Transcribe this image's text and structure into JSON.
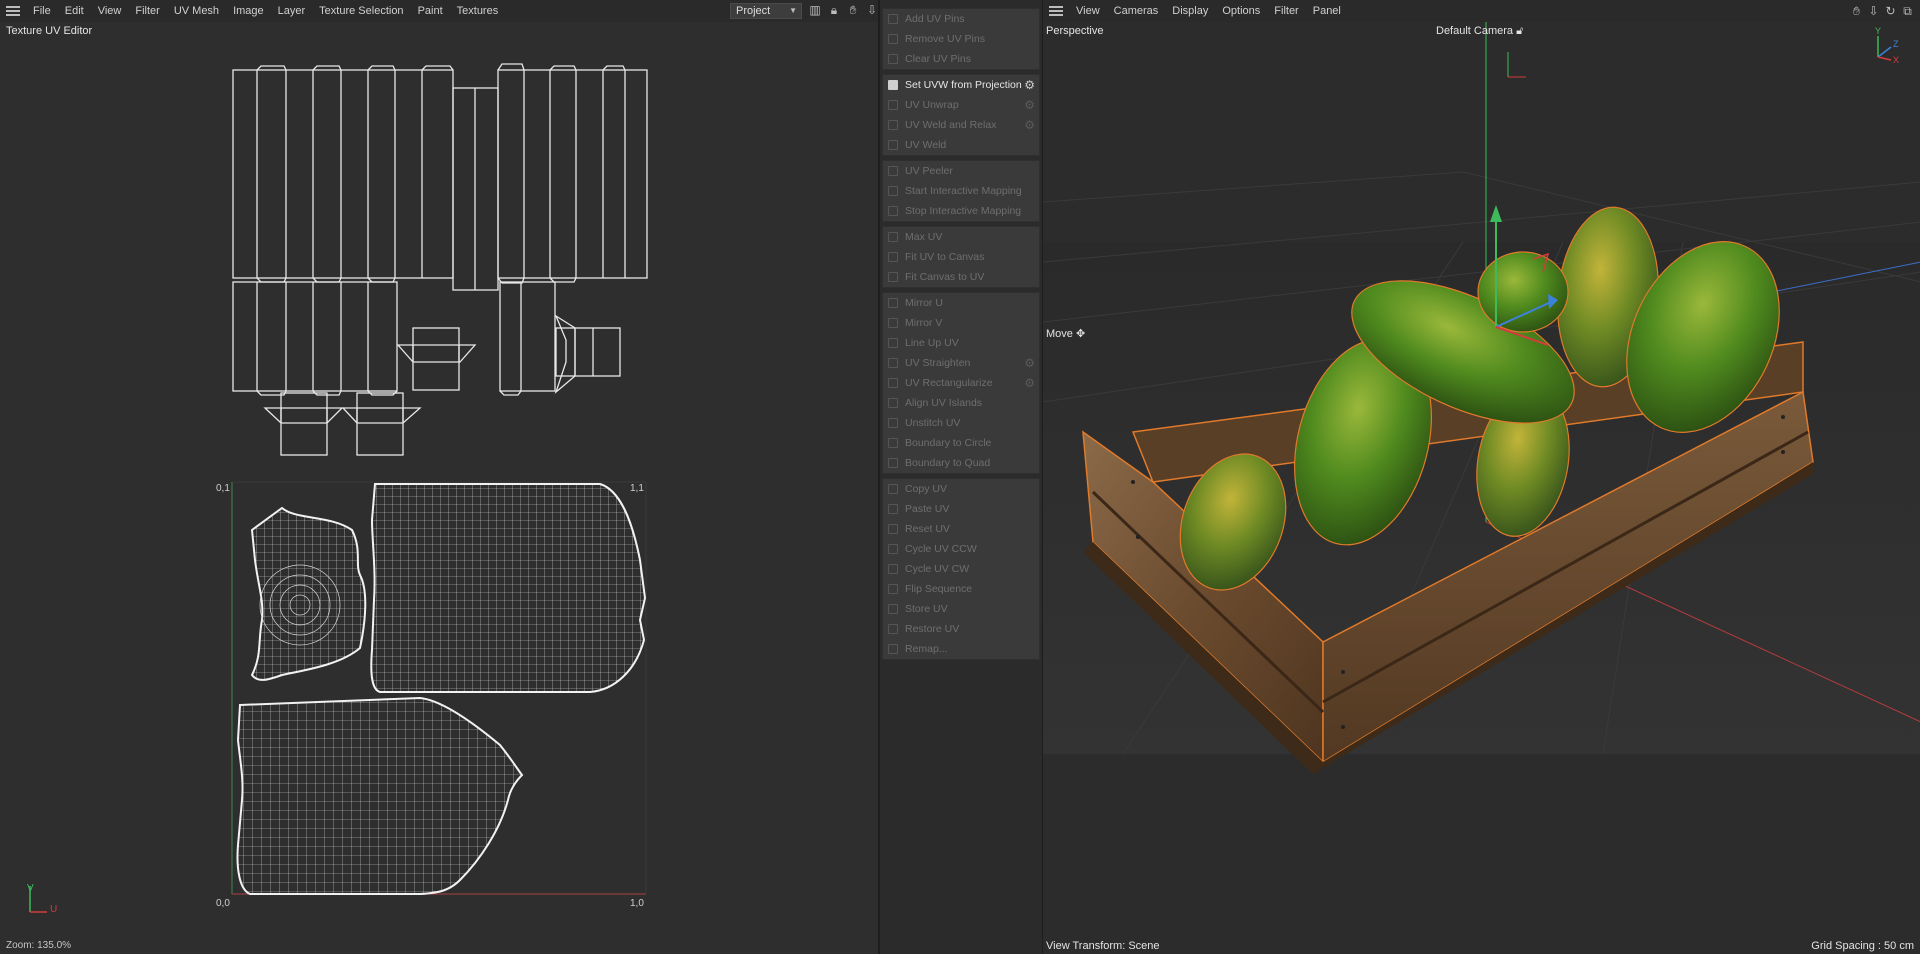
{
  "uv_editor": {
    "menu": [
      "File",
      "Edit",
      "View",
      "Filter",
      "UV Mesh",
      "Image",
      "Layer",
      "Texture Selection",
      "Paint",
      "Textures"
    ],
    "title": "Texture UV Editor",
    "project_select": "Project",
    "toolbar_icons": [
      "histogram-icon",
      "lock-icon",
      "hand-icon",
      "pin-icon"
    ],
    "corner_labels": {
      "top_left": "0,1",
      "top_right": "1,1",
      "bottom_left": "0,0",
      "bottom_right": "1,0"
    },
    "axis": {
      "v": "V",
      "u": "U"
    },
    "status": "Zoom: 135.0%"
  },
  "commands": [
    [
      {
        "label": "Add UV Pins",
        "icon": "pin-add-icon",
        "active": false
      },
      {
        "label": "Remove UV Pins",
        "icon": "pin-remove-icon",
        "active": false
      },
      {
        "label": "Clear UV Pins",
        "icon": "clear-icon",
        "active": false
      }
    ],
    [
      {
        "label": "Set UVW from Projection",
        "icon": "projection-icon",
        "active": true,
        "gear": true
      },
      {
        "label": "UV Unwrap",
        "icon": "unwrap-icon",
        "active": false,
        "gear": true
      },
      {
        "label": "UV Weld and Relax",
        "icon": "relax-icon",
        "active": false,
        "gear": true
      },
      {
        "label": "UV Weld",
        "icon": "weld-icon",
        "active": false
      }
    ],
    [
      {
        "label": "UV Peeler",
        "icon": "peeler-icon",
        "active": false
      },
      {
        "label": "Start Interactive Mapping",
        "icon": "play-icon",
        "active": false
      },
      {
        "label": "Stop Interactive Mapping",
        "icon": "stop-icon",
        "active": false
      }
    ],
    [
      {
        "label": "Max UV",
        "icon": "max-icon",
        "active": false
      },
      {
        "label": "Fit UV to Canvas",
        "icon": "fit-icon",
        "active": false
      },
      {
        "label": "Fit Canvas to UV",
        "icon": "fit-canvas-icon",
        "active": false
      }
    ],
    [
      {
        "label": "Mirror U",
        "icon": "mirror-u-icon",
        "active": false
      },
      {
        "label": "Mirror V",
        "icon": "mirror-v-icon",
        "active": false
      },
      {
        "label": "Line Up UV",
        "icon": "lineup-icon",
        "active": false
      },
      {
        "label": "UV Straighten",
        "icon": "straighten-icon",
        "active": false,
        "gear": true
      },
      {
        "label": "UV Rectangularize",
        "icon": "rect-icon",
        "active": false,
        "gear": true
      },
      {
        "label": "Align UV Islands",
        "icon": "align-icon",
        "active": false
      },
      {
        "label": "Unstitch UV",
        "icon": "unstitch-icon",
        "active": false
      },
      {
        "label": "Boundary to Circle",
        "icon": "circle-icon",
        "active": false
      },
      {
        "label": "Boundary to Quad",
        "icon": "quad-icon",
        "active": false
      }
    ],
    [
      {
        "label": "Copy UV",
        "icon": "copy-icon",
        "active": false
      },
      {
        "label": "Paste UV",
        "icon": "paste-icon",
        "active": false
      },
      {
        "label": "Reset UV",
        "icon": "reset-icon",
        "active": false
      },
      {
        "label": "Cycle UV CCW",
        "icon": "ccw-icon",
        "active": false
      },
      {
        "label": "Cycle UV CW",
        "icon": "cw-icon",
        "active": false
      },
      {
        "label": "Flip Sequence",
        "icon": "flip-icon",
        "active": false
      },
      {
        "label": "Store UV",
        "icon": "store-icon",
        "active": false
      },
      {
        "label": "Restore UV",
        "icon": "restore-icon",
        "active": false
      },
      {
        "label": "Remap...",
        "icon": "remap-icon",
        "active": false
      }
    ]
  ],
  "viewport": {
    "menu": [
      "View",
      "Cameras",
      "Display",
      "Options",
      "Filter",
      "Panel"
    ],
    "view_name": "Perspective",
    "camera": "Default Camera",
    "tool": "Move",
    "view_transform": "View Transform: Scene",
    "grid_spacing": "Grid Spacing : 50 cm",
    "axis_labels": {
      "y": "Y",
      "z": "Z",
      "x": "X"
    },
    "toolbar_icons": [
      "hand-icon",
      "pin-icon",
      "rotate-icon",
      "maximize-icon"
    ]
  },
  "colors": {
    "background": "#2b2b2b",
    "uv_lines": "#e8e8e8",
    "axis_green": "#3dbb5a",
    "axis_red": "#d23c3c",
    "axis_blue": "#3c82dc",
    "selection_orange": "#e07a2a",
    "papaya_green": "#4f8a1e",
    "crate_wood": "#6b4b2e"
  }
}
